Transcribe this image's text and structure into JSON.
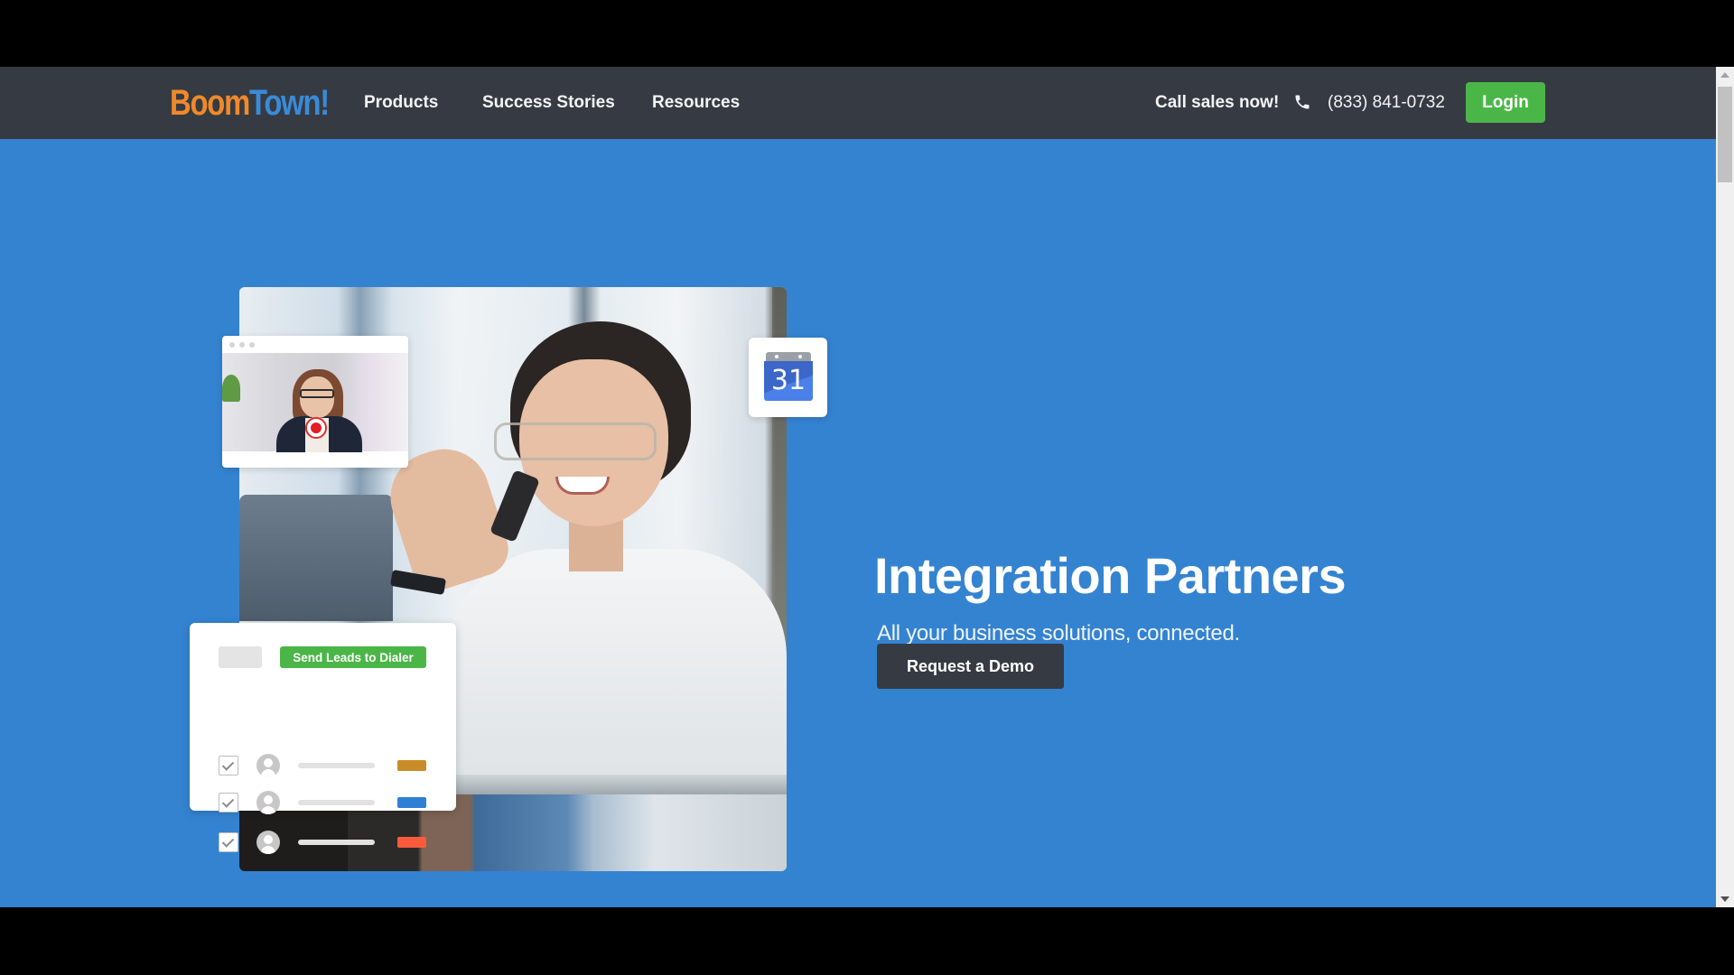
{
  "header": {
    "logo": {
      "part1": "Boom",
      "part2": "Town!",
      "part1_color": "#f0892a",
      "part2_color": "#3a8bd8"
    },
    "nav": [
      {
        "label": "Products"
      },
      {
        "label": "Success Stories"
      },
      {
        "label": "Resources"
      }
    ],
    "call_label": "Call sales now!",
    "phone_icon": "phone-icon",
    "phone_number": "(833) 841-0732",
    "login_label": "Login"
  },
  "hero": {
    "title": "Integration Partners",
    "subtitle": "All your business solutions, connected.",
    "cta_label": "Request a Demo",
    "calendar_day": "31",
    "leads_card": {
      "button_label": "Send Leads to Dialer",
      "rows": [
        {
          "checked": true,
          "tag_color": "#c98c28"
        },
        {
          "checked": true,
          "tag_color": "#2f7fd4"
        },
        {
          "checked": true,
          "tag_color": "#fa5a3c"
        }
      ]
    }
  },
  "colors": {
    "header_bg": "#363b43",
    "hero_bg": "#3483d1",
    "accent_green": "#4bb648",
    "button_dark": "#363b43"
  }
}
